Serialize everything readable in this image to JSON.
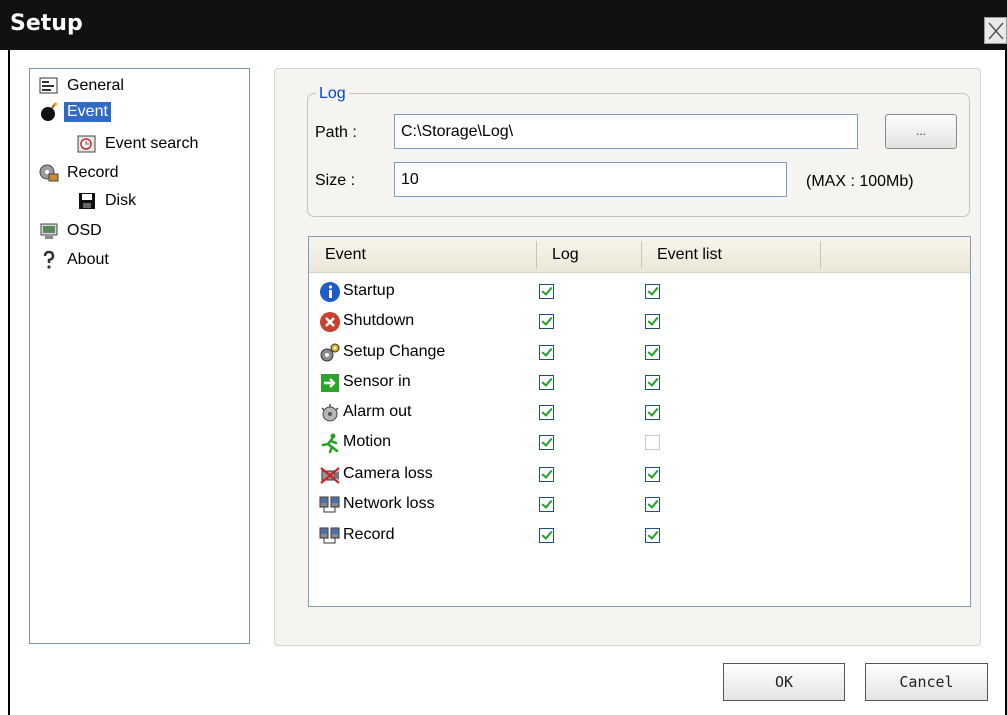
{
  "window": {
    "title": "Setup"
  },
  "tree": [
    {
      "label": "General",
      "icon": "general-icon",
      "selected": false
    },
    {
      "label": "Event",
      "icon": "bomb-icon",
      "selected": true
    },
    {
      "label": "Event search",
      "icon": "event-search-icon",
      "selected": false
    },
    {
      "label": "Record",
      "icon": "film-reel-icon",
      "selected": false
    },
    {
      "label": "Disk",
      "icon": "floppy-disk-icon",
      "selected": false
    },
    {
      "label": "OSD",
      "icon": "monitor-icon",
      "selected": false
    },
    {
      "label": "About",
      "icon": "question-icon",
      "selected": false
    }
  ],
  "log": {
    "legend": "Log",
    "path_label": "Path :",
    "path_value": "C:\\Storage\\Log\\",
    "browse_label": "...",
    "size_label": "Size :",
    "size_value": "10",
    "max_note": "(MAX : 100Mb)"
  },
  "event_table": {
    "columns": [
      "Event",
      "Log",
      "Event list"
    ],
    "rows": [
      {
        "name": "Startup",
        "icon": "info-icon",
        "log": true,
        "event_list": true
      },
      {
        "name": "Shutdown",
        "icon": "shutdown-icon",
        "log": true,
        "event_list": true
      },
      {
        "name": "Setup Change",
        "icon": "gears-icon",
        "log": true,
        "event_list": true
      },
      {
        "name": "Sensor in",
        "icon": "sensor-arrow-icon",
        "log": true,
        "event_list": true
      },
      {
        "name": "Alarm out",
        "icon": "alarm-icon",
        "log": true,
        "event_list": true
      },
      {
        "name": "Motion",
        "icon": "running-man-icon",
        "log": true,
        "event_list": false
      },
      {
        "name": "Camera loss",
        "icon": "camera-loss-icon",
        "log": true,
        "event_list": true
      },
      {
        "name": "Network loss",
        "icon": "network-icon",
        "log": true,
        "event_list": true
      },
      {
        "name": "Record",
        "icon": "network-record-icon",
        "log": true,
        "event_list": true
      }
    ]
  },
  "buttons": {
    "ok": "OK",
    "cancel": "Cancel"
  },
  "colors": {
    "selection": "#316ac5",
    "legend": "#0046d5",
    "check": "#21a121",
    "titlebar": "#111111"
  }
}
